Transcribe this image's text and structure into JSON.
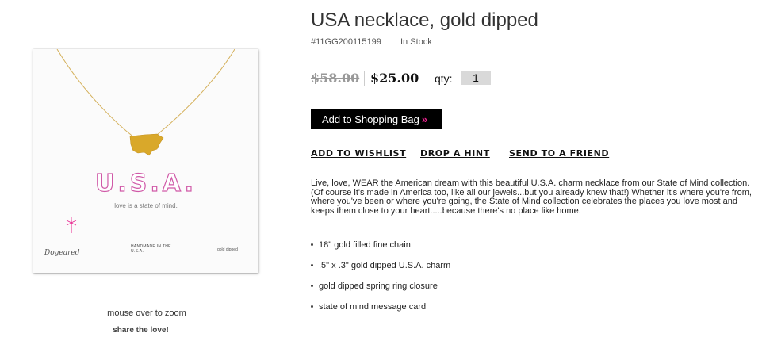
{
  "product": {
    "title": "USA necklace, gold dipped",
    "sku": "#11GG200115199",
    "stock": "In Stock",
    "price_old": "$58.00",
    "price_new": "$25.00",
    "qty_label": "qty:",
    "qty_value": "1"
  },
  "card": {
    "headline": "U.S.A.",
    "tagline": "love is a state of mind.",
    "brand": "Dogeared",
    "handmade": "HANDMADE IN THE U.S.A.",
    "finish": "gold dipped"
  },
  "image_panel": {
    "zoom_hint": "mouse over to zoom",
    "share": "share the love!"
  },
  "actions": {
    "add_to_bag": "Add to Shopping Bag",
    "add_to_bag_chevron": "»",
    "wishlist": "ADD TO WISHLIST",
    "hint": "DROP A HINT",
    "friend": "SEND TO A FRIEND"
  },
  "description": "Live, love, WEAR the American dream with this beautiful U.S.A. charm necklace from our State of Mind collection. (Of course it's made in America too, like all our jewels...but you already knew that!) Whether it's where you're from, where you've been or where you're going, the State of Mind collection celebrates the places you love most and keeps them close to your heart.....because there's no place like home.",
  "features": [
    "18\" gold filled fine chain",
    ".5\" x .3\" gold dipped U.S.A. charm",
    "gold dipped spring ring closure",
    "state of mind message card"
  ],
  "colors": {
    "accent_pink": "#e8248e",
    "button_bg": "#000000",
    "gold": "#d4a52a"
  }
}
